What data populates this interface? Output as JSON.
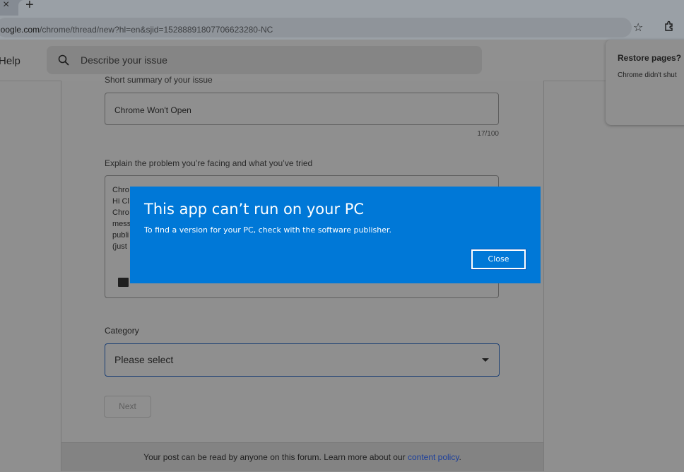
{
  "browser": {
    "url_domain": "google.com",
    "url_path": "/chrome/thread/new?hl=en&sjid=15288891807706623280-NC"
  },
  "header": {
    "help_label": "Help",
    "search_placeholder": "Describe your issue"
  },
  "restore_popup": {
    "title": "Restore pages?",
    "text": "Chrome didn't shut"
  },
  "form": {
    "summary_label": "Short summary of your issue",
    "summary_value": "Chrome Won't Open",
    "summary_count": "17/100",
    "explain_label": "Explain the problem you’re facing and what you’ve tried",
    "explain_lines": [
      "Chro",
      "Hi Cl",
      "Chro",
      "mess",
      "publi",
      "(just"
    ],
    "category_label": "Category",
    "category_value": "Please select",
    "next_label": "Next",
    "footer_text": "Your post can be read by anyone on this forum. Learn more about our ",
    "footer_link": "content policy",
    "footer_end": "."
  },
  "dialog": {
    "title": "This app can’t run on your PC",
    "message": "To find a version for your PC, check with the software publisher.",
    "close_label": "Close",
    "accent": "#0078d7"
  }
}
